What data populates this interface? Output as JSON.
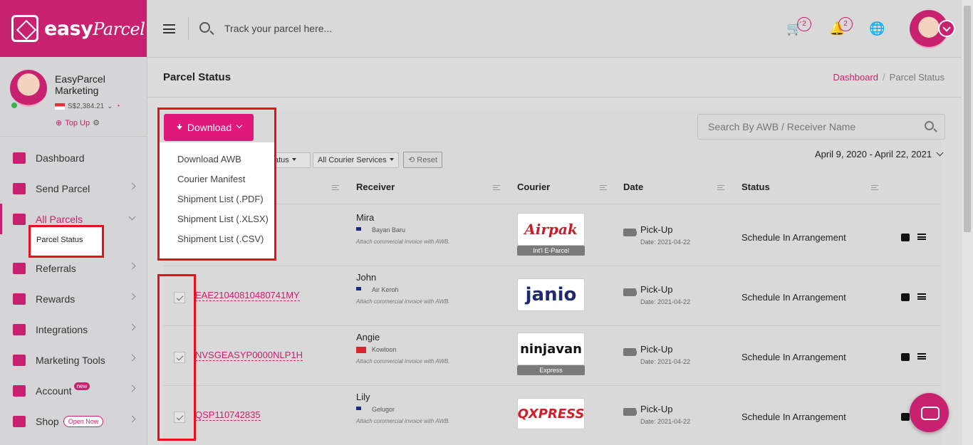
{
  "brand": {
    "name": "easy",
    "name_script": "Parcel"
  },
  "header": {
    "search_placeholder": "Track your parcel here...",
    "cart_count": "2",
    "notif_count": "2"
  },
  "profile": {
    "name_line1": "EasyParcel",
    "name_line2": "Marketing",
    "balance": "S$2,384.21",
    "topup": "Top Up"
  },
  "sidebar": {
    "items": [
      {
        "label": "Dashboard"
      },
      {
        "label": "Send Parcel"
      },
      {
        "label": "All Parcels"
      },
      {
        "label": "Referrals"
      },
      {
        "label": "Rewards"
      },
      {
        "label": "Integrations"
      },
      {
        "label": "Marketing Tools"
      },
      {
        "label": "Account",
        "badge": "new"
      },
      {
        "label": "Shop",
        "badge": "Open Now"
      }
    ],
    "sub_item": "Parcel Status"
  },
  "page": {
    "title": "Parcel Status",
    "breadcrumb_home": "Dashboard",
    "breadcrumb_current": "Parcel Status",
    "search_placeholder": "Search By AWB / Receiver Name",
    "date_range": "April 9, 2020 - April 22, 2021"
  },
  "download": {
    "label": "Download",
    "options": [
      "Download AWB",
      "Courier Manifest",
      "Shipment List (.PDF)",
      "Shipment List (.XLSX)",
      "Shipment List (.CSV)"
    ]
  },
  "filters": {
    "status_partial": "atus",
    "courier": "All Courier Services",
    "reset": "Reset"
  },
  "table": {
    "headers": [
      "Receiver",
      "Courier",
      "Date",
      "Status"
    ],
    "rows": [
      {
        "awb": "",
        "name": "Mira",
        "city": "Bayan Baru",
        "flag": "my",
        "note": "Attach commercial invoice with AWB.",
        "courier": "Airpak",
        "courier_tag": "Int'l E-Parcel",
        "pickup": "Pick-Up",
        "date": "Date: 2021-04-22",
        "status": "Schedule In Arrangement"
      },
      {
        "awb": "EAE21040810480741MY",
        "name": "John",
        "city": "Air Keroh",
        "flag": "my",
        "note": "Attach commercial invoice with AWB.",
        "courier": "janio",
        "courier_tag": "",
        "pickup": "Pick-Up",
        "date": "Date: 2021-04-22",
        "status": "Schedule In Arrangement"
      },
      {
        "awb": "NVSGEASYP0000NLP1H",
        "name": "Angie",
        "city": "Kowloon",
        "flag": "hk",
        "note": "Attach commercial invoice with AWB.",
        "courier": "ninjavan",
        "courier_tag": "Express",
        "pickup": "Pick-Up",
        "date": "Date: 2021-04-22",
        "status": "Schedule In Arrangement"
      },
      {
        "awb": "QSP110742835",
        "name": "Lily",
        "city": "Gelugor",
        "flag": "my",
        "note": "Attach commercial invoice with AWB.",
        "courier": "QXPRESS",
        "courier_tag": "",
        "pickup": "Pick-Up",
        "date": "Date: 2021-04-22",
        "status": "Schedule In Arrangement"
      }
    ]
  }
}
